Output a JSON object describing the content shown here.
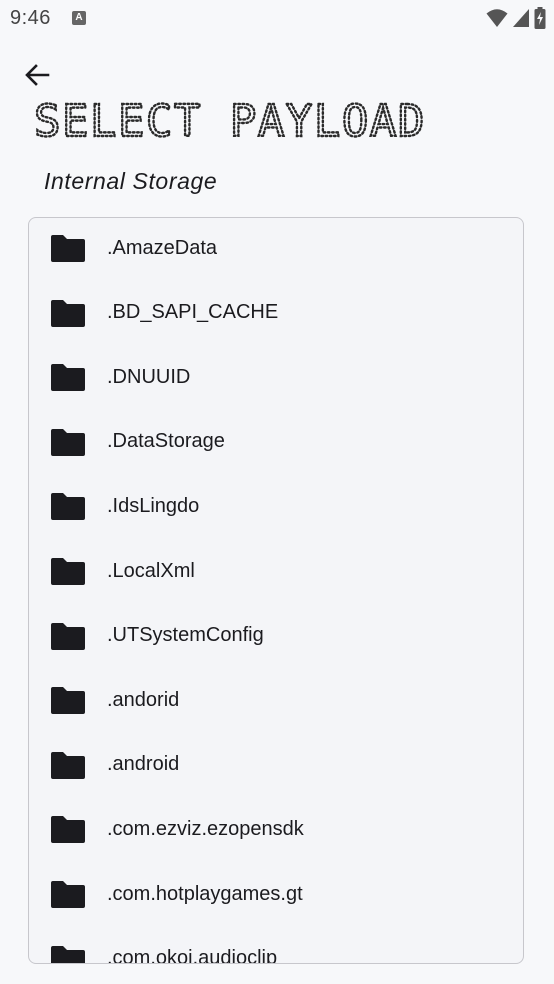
{
  "status_bar": {
    "time": "9:46",
    "app_icon": "A",
    "icons": [
      "wifi-icon",
      "cellular-signal-icon",
      "battery-charging-icon"
    ]
  },
  "toolbar": {
    "back_icon": "arrow-left-icon"
  },
  "title": "SELECT PAYLOAD",
  "section_label": "Internal Storage",
  "folders": [
    {
      "name": ".AmazeData",
      "icon": "folder-icon"
    },
    {
      "name": ".BD_SAPI_CACHE",
      "icon": "folder-icon"
    },
    {
      "name": ".DNUUID",
      "icon": "folder-icon"
    },
    {
      "name": ".DataStorage",
      "icon": "folder-icon"
    },
    {
      "name": ".IdsLingdo",
      "icon": "folder-icon"
    },
    {
      "name": ".LocalXml",
      "icon": "folder-icon"
    },
    {
      "name": ".UTSystemConfig",
      "icon": "folder-icon"
    },
    {
      "name": ".andorid",
      "icon": "folder-icon"
    },
    {
      "name": ".android",
      "icon": "folder-icon"
    },
    {
      "name": ".com.ezviz.ezopensdk",
      "icon": "folder-icon"
    },
    {
      "name": ".com.hotplaygames.gt",
      "icon": "folder-icon"
    },
    {
      "name": ".com.okoi.audioclip",
      "icon": "folder-icon"
    }
  ]
}
